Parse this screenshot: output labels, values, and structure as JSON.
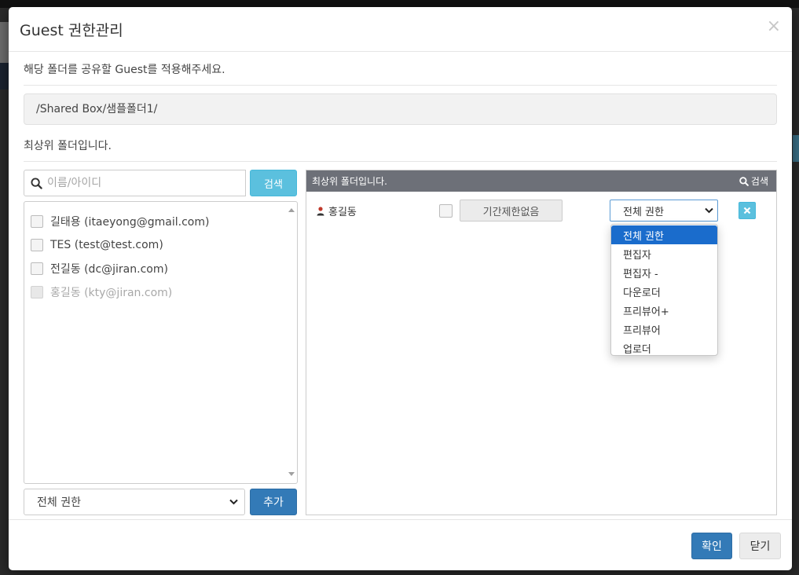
{
  "modal": {
    "title": "Guest 권한관리",
    "close_symbol": "×",
    "instruction": "해당 폴더를 공유할 Guest를 적용해주세요.",
    "path": "/Shared Box/샘플폴더1/",
    "top_folder_note": "최상위 폴더입니다."
  },
  "left_panel": {
    "search_placeholder": "이름/아이디",
    "search_button": "검색",
    "users": [
      {
        "label": "길태용 (itaeyong@gmail.com)",
        "disabled": false
      },
      {
        "label": "TES (test@test.com)",
        "disabled": false
      },
      {
        "label": "전길동 (dc@jiran.com)",
        "disabled": false
      },
      {
        "label": "홍길동 (kty@jiran.com)",
        "disabled": true
      }
    ],
    "permission_select": "전체 권한",
    "add_button": "추가"
  },
  "right_panel": {
    "header_title": "최상위 폴더입니다.",
    "header_search": "검색",
    "member": {
      "name": "홍길동",
      "period_button": "기간제한없음",
      "role_selected": "전체 권한"
    },
    "role_options": [
      "전체 권한",
      "편집자",
      "편집자 -",
      "다운로더",
      "프리뷰어+",
      "프리뷰어",
      "업로더"
    ]
  },
  "footer": {
    "ok_button": "확인",
    "close_button": "닫기"
  },
  "colors": {
    "primary": "#337ab7",
    "info": "#5bc0de",
    "header_gray": "#6d7078",
    "selected_option": "#1a6ccc"
  },
  "icons": [
    "search-icon",
    "user-icon",
    "remove-icon",
    "chevron-down-icon",
    "close-icon"
  ]
}
